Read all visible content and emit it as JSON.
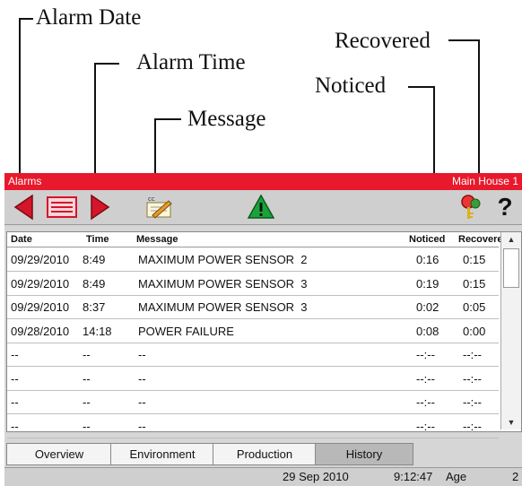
{
  "annotations": {
    "alarm_date": "Alarm Date",
    "alarm_time": "Alarm Time",
    "message": "Message",
    "noticed": "Noticed",
    "recovered": "Recovered"
  },
  "window": {
    "title": "Alarms",
    "location": "Main House 1"
  },
  "toolbar": {
    "icons": [
      "back-arrow-icon",
      "list-icon",
      "forward-arrow-icon",
      "notes-icon",
      "warning-icon",
      "key-icon",
      "help-icon"
    ],
    "help_label": "?"
  },
  "table": {
    "headers": {
      "date": "Date",
      "time": "Time",
      "message": "Message",
      "noticed": "Noticed",
      "recovered": "Recovered"
    },
    "rows": [
      {
        "date": "09/29/2010",
        "time": "8:49",
        "message": "MAXIMUM POWER SENSOR  2",
        "noticed": "0:16",
        "recovered": "0:15"
      },
      {
        "date": "09/29/2010",
        "time": "8:49",
        "message": "MAXIMUM POWER SENSOR  3",
        "noticed": "0:19",
        "recovered": "0:15"
      },
      {
        "date": "09/29/2010",
        "time": "8:37",
        "message": "MAXIMUM POWER SENSOR  3",
        "noticed": "0:02",
        "recovered": "0:05"
      },
      {
        "date": "09/28/2010",
        "time": "14:18",
        "message": "POWER FAILURE",
        "noticed": "0:08",
        "recovered": "0:00"
      },
      {
        "date": "--",
        "time": "--",
        "message": "--",
        "noticed": "--:--",
        "recovered": "--:--"
      },
      {
        "date": "--",
        "time": "--",
        "message": "--",
        "noticed": "--:--",
        "recovered": "--:--"
      },
      {
        "date": "--",
        "time": "--",
        "message": "--",
        "noticed": "--:--",
        "recovered": "--:--"
      },
      {
        "date": "--",
        "time": "--",
        "message": "--",
        "noticed": "--:--",
        "recovered": "--:--"
      }
    ]
  },
  "tabs": [
    {
      "label": "Overview",
      "active": false
    },
    {
      "label": "Environment",
      "active": false
    },
    {
      "label": "Production",
      "active": false
    },
    {
      "label": "History",
      "active": true
    }
  ],
  "status": {
    "date": "29 Sep 2010",
    "time": "9:12:47",
    "age_label": "Age",
    "age_value": "2"
  },
  "colors": {
    "titlebar": "#e8192c",
    "warning": "#1aa33a",
    "toolbar": "#cfcfcf"
  }
}
